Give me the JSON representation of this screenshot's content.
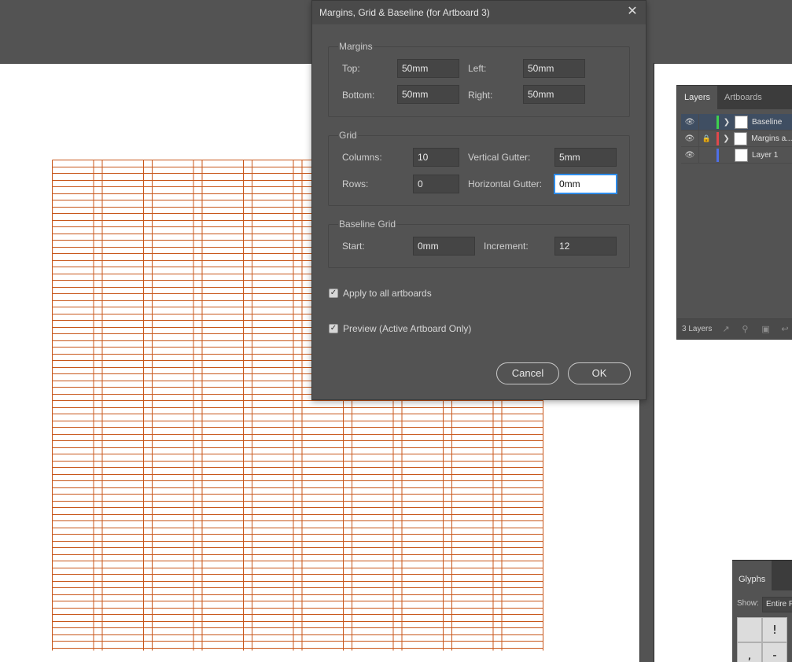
{
  "dialog": {
    "title": "Margins, Grid & Baseline (for Artboard 3)",
    "close_icon": "close-icon",
    "margins": {
      "label": "Margins",
      "top_label": "Top:",
      "top_value": "50mm",
      "left_label": "Left:",
      "left_value": "50mm",
      "bottom_label": "Bottom:",
      "bottom_value": "50mm",
      "right_label": "Right:",
      "right_value": "50mm"
    },
    "grid": {
      "label": "Grid",
      "columns_label": "Columns:",
      "columns_value": "10",
      "vgutter_label": "Vertical Gutter:",
      "vgutter_value": "5mm",
      "rows_label": "Rows:",
      "rows_value": "0",
      "hgutter_label": "Horizontal Gutter:",
      "hgutter_value": "0mm"
    },
    "baseline": {
      "label": "Baseline Grid",
      "start_label": "Start:",
      "start_value": "0mm",
      "increment_label": "Increment:",
      "increment_value": "12"
    },
    "apply_all_label": "Apply to all artboards",
    "apply_all_checked": true,
    "preview_label": "Preview (Active Artboard Only)",
    "preview_checked": true,
    "cancel_label": "Cancel",
    "ok_label": "OK"
  },
  "layers_panel": {
    "tabs": [
      "Layers",
      "Artboards"
    ],
    "active_tab": "Layers",
    "layers": [
      {
        "name": "Baseline",
        "color": "#3ecf4e",
        "locked": false,
        "expandable": true,
        "selected": true
      },
      {
        "name": "Margins a...",
        "color": "#e0484b",
        "locked": true,
        "expandable": true,
        "selected": false
      },
      {
        "name": "Layer 1",
        "color": "#4f6fe6",
        "locked": false,
        "expandable": false,
        "selected": false
      }
    ],
    "footer_count": "3 Layers"
  },
  "glyphs_panel": {
    "tab": "Glyphs",
    "show_label": "Show:",
    "show_value": "Entire F",
    "glyphs": [
      "!",
      ",",
      "-"
    ]
  },
  "canvas": {
    "grid_color": "#c8571b"
  }
}
